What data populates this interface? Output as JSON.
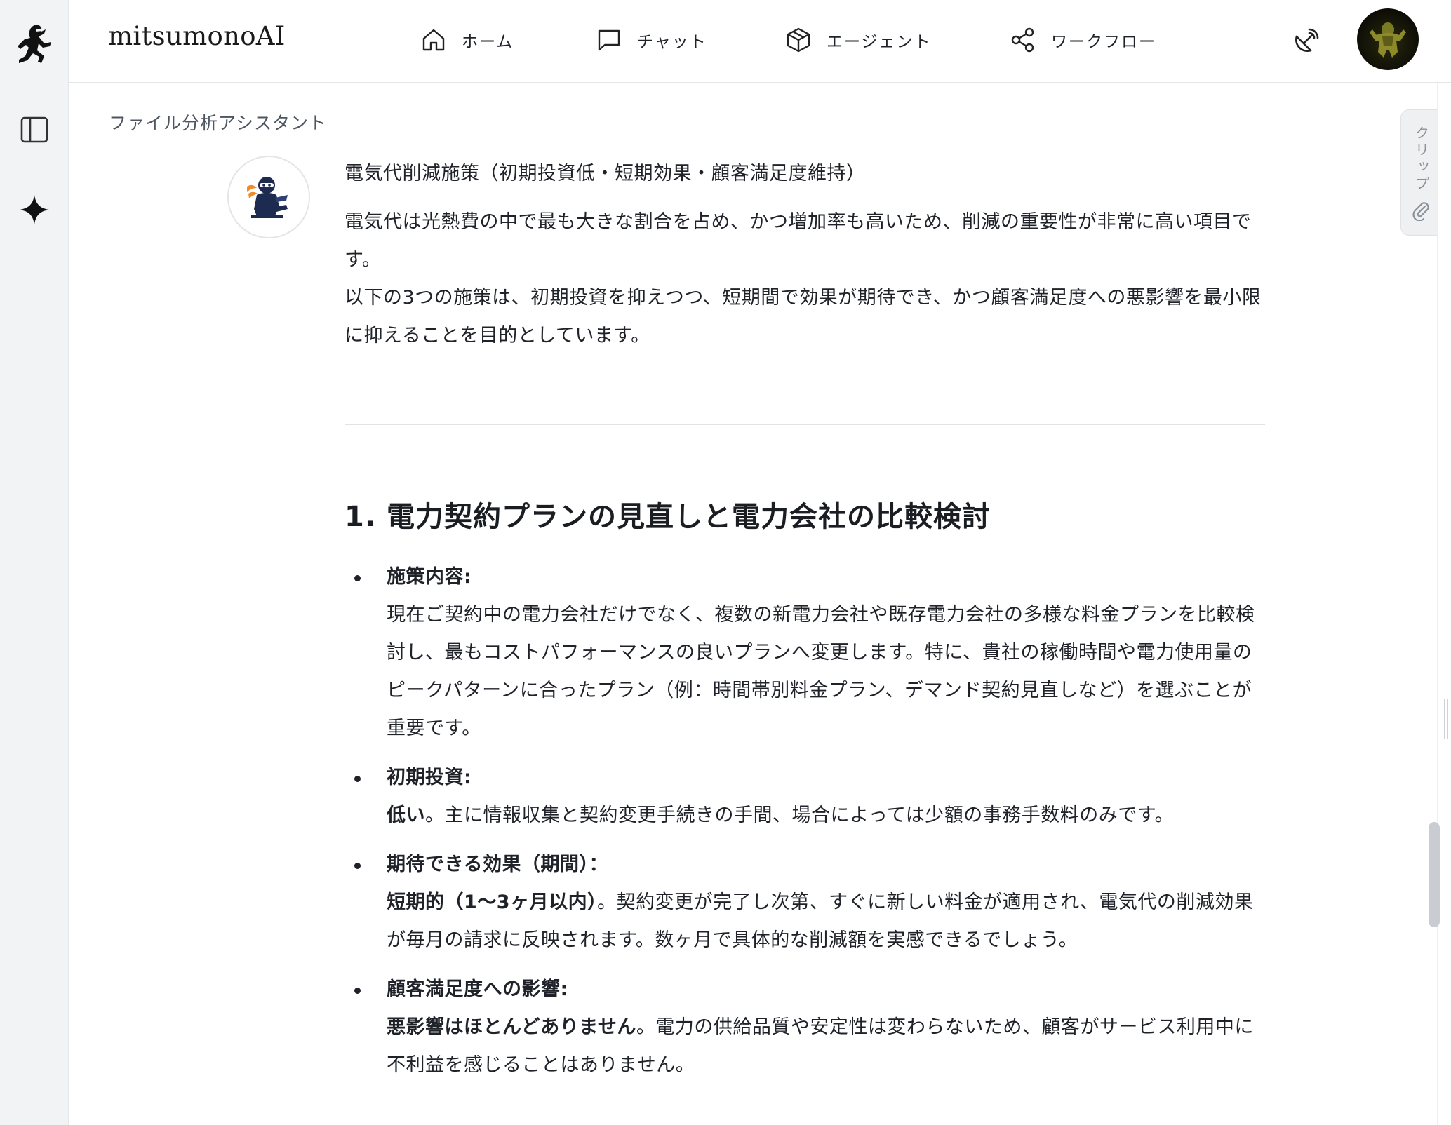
{
  "app": {
    "brand": "mitsumonoAI"
  },
  "nav": {
    "items": [
      {
        "label": "ホーム",
        "icon": "home-icon"
      },
      {
        "label": "チャット",
        "icon": "chat-icon"
      },
      {
        "label": "エージェント",
        "icon": "cube-icon"
      },
      {
        "label": "ワークフロー",
        "icon": "share-icon"
      }
    ]
  },
  "page": {
    "title": "ファイル分析アシスタント"
  },
  "clip_tab": {
    "label": "クリップ"
  },
  "message": {
    "lead": "電気代削減施策（初期投資低・短期効果・顧客満足度維持）",
    "para1": "電気代は光熱費の中で最も大きな割合を占め、かつ増加率も高いため、削減の重要性が非常に高い項目です。",
    "para2": "以下の3つの施策は、初期投資を抑えつつ、短期間で効果が期待でき、かつ顧客満足度への悪影響を最小限に抑えることを目的としています。",
    "heading": "1. 電力契約プランの見直しと電力会社の比較検討",
    "bullets": [
      {
        "label": "施策内容:",
        "body_bold": "",
        "body": "現在ご契約中の電力会社だけでなく、複数の新電力会社や既存電力会社の多様な料金プランを比較検討し、最もコストパフォーマンスの良いプランへ変更します。特に、貴社の稼働時間や電力使用量のピークパターンに合ったプラン（例：時間帯別料金プラン、デマンド契約見直しなど）を選ぶことが重要です。"
      },
      {
        "label": "初期投資:",
        "body_bold": "低い",
        "body": "。主に情報収集と契約変更手続きの手間、場合によっては少額の事務手数料のみです。"
      },
      {
        "label": "期待できる効果（期間）：",
        "body_bold": "短期的（1〜3ヶ月以内）",
        "body": "。契約変更が完了し次第、すぐに新しい料金が適用され、電気代の削減効果が毎月の請求に反映されます。数ヶ月で具体的な削減額を実感できるでしょう。"
      },
      {
        "label": "顧客満足度への影響:",
        "body_bold": "悪影響はほとんどありません",
        "body": "。電力の供給品質や安定性は変わらないため、顧客がサービス利用中に不利益を感じることはありません。"
      }
    ]
  }
}
